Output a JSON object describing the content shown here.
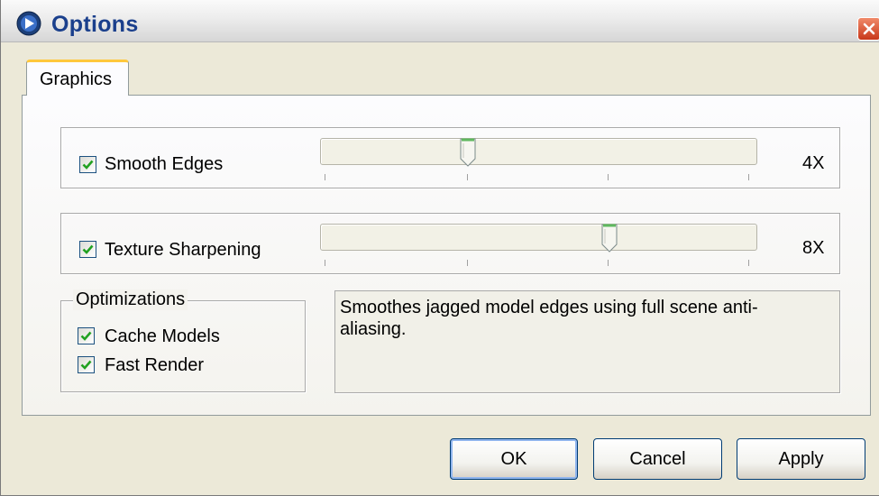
{
  "window": {
    "title": "Options"
  },
  "tabs": [
    {
      "label": "Graphics",
      "selected": true
    }
  ],
  "smooth_edges": {
    "label": "Smooth Edges",
    "checked": true,
    "value_label": "4X",
    "slider_position": 0.333,
    "tick_count": 4
  },
  "texture_sharpening": {
    "label": "Texture Sharpening",
    "checked": true,
    "value_label": "8X",
    "slider_position": 0.667,
    "tick_count": 4
  },
  "optimizations": {
    "title": "Optimizations",
    "items": [
      {
        "label": "Cache Models",
        "checked": true
      },
      {
        "label": "Fast Render",
        "checked": true
      }
    ]
  },
  "description": "Smoothes jagged model edges using full scene anti-aliasing.",
  "buttons": {
    "ok": "OK",
    "cancel": "Cancel",
    "apply": "Apply"
  },
  "icons": {
    "app": "app-logo-icon",
    "close": "close-icon",
    "check": "checkmark-icon",
    "slider_thumb": "slider-thumb-icon"
  },
  "colors": {
    "title_text": "#1a3f8c",
    "check": "#21a121",
    "tab_highlight": "#ffc83c",
    "close_button": "#c8381a",
    "thumb": "#5fb85f"
  }
}
